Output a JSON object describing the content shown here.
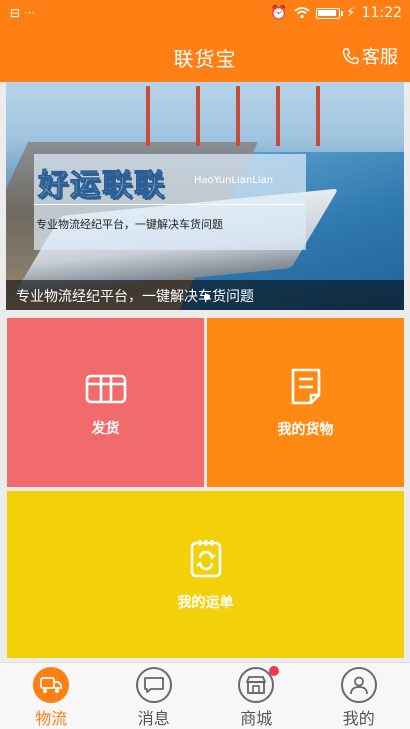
{
  "status_bar": {
    "left_text": "⊟ ···",
    "time": "11:22",
    "battery_level": 0.85
  },
  "header": {
    "title": "联货宝",
    "service_label": "客服"
  },
  "banner": {
    "brand": "好运联联",
    "pinyin": "HaoYunLianLian",
    "slogan_small": "专业物流经纪平台，一键解决车货问题",
    "caption": "专业物流经纪平台，一键解决车货问题"
  },
  "tiles": {
    "ship": {
      "label": "发货",
      "icon": "gift-box-icon",
      "color": "#f26b6c"
    },
    "goods": {
      "label": "我的货物",
      "icon": "document-icon",
      "color": "#fe8a13"
    },
    "waybill": {
      "label": "我的运单",
      "icon": "clipboard-refresh-icon",
      "color": "#f3d10a"
    }
  },
  "tabs": [
    {
      "label": "物流",
      "icon": "truck-icon",
      "active": true
    },
    {
      "label": "消息",
      "icon": "message-icon",
      "active": false,
      "badge": true
    },
    {
      "label": "商城",
      "icon": "store-icon",
      "active": false
    },
    {
      "label": "我的",
      "icon": "user-icon",
      "active": false
    }
  ],
  "colors": {
    "accent": "#ff7f14",
    "badge": "#f2354a"
  }
}
